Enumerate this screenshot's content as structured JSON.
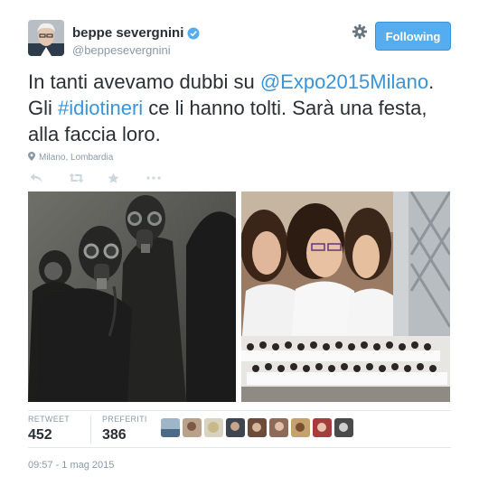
{
  "user": {
    "name": "beppe severgnini",
    "screen_name": "@beppesevergnini",
    "verified": true
  },
  "follow_button": {
    "label": "Following"
  },
  "tweet": {
    "line1_text": "In tanti avevamo dubbi su ",
    "line1_link": "@Expo2015Milano",
    "line1_end": ".",
    "line2_text": "Gli ",
    "line2_hashtag": "#idiotineri",
    "line2_end": " ce li hanno tolti. Sarà una festa,",
    "line3_text": "alla faccia loro."
  },
  "location": "Milano, Lombardia",
  "actions": [
    "reply-icon",
    "retweet-icon",
    "favorite-icon",
    "more-icon"
  ],
  "media": [
    {
      "name": "photo-gas-masks",
      "description": "people wearing gas masks"
    },
    {
      "name": "photo-choir",
      "description": "girls singing choir on screen"
    }
  ],
  "stats": {
    "retweet_label": "RETWEET",
    "retweet_count": "452",
    "favorites_label": "PREFERITI",
    "favorites_count": "386"
  },
  "favoriters_count_shown": 9,
  "timestamp": "09:57 - 1 mag 2015",
  "colors": {
    "link": "#3b94d9",
    "follow_bg": "#55acee",
    "muted": "#8899a6",
    "text": "#292f33",
    "verified": "#55acee"
  }
}
